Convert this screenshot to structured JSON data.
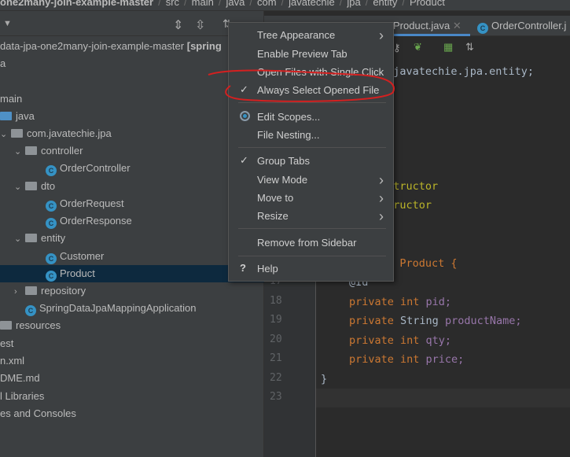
{
  "breadcrumb": [
    "one2many-join-example-master",
    "src",
    "main",
    "java",
    "com",
    "javatechie",
    "jpa",
    "entity",
    "Product"
  ],
  "project": {
    "root_label": "data-jpa-one2many-join-example-master",
    "root_suffix": "[spring",
    "rows": [
      {
        "label": "a",
        "indent": 0,
        "icon": "none"
      },
      {
        "label": "main",
        "indent": 0,
        "icon": "none"
      },
      {
        "label": "java",
        "indent": 0,
        "icon": "folder-blue"
      },
      {
        "label": "com.javatechie.jpa",
        "indent": 1,
        "icon": "package",
        "chevron": "down"
      },
      {
        "label": "controller",
        "indent": 2,
        "icon": "package",
        "chevron": "down"
      },
      {
        "label": "OrderController",
        "indent": 3,
        "icon": "class"
      },
      {
        "label": "dto",
        "indent": 2,
        "icon": "package",
        "chevron": "down"
      },
      {
        "label": "OrderRequest",
        "indent": 3,
        "icon": "class"
      },
      {
        "label": "OrderResponse",
        "indent": 3,
        "icon": "class"
      },
      {
        "label": "entity",
        "indent": 2,
        "icon": "package",
        "chevron": "down"
      },
      {
        "label": "Customer",
        "indent": 3,
        "icon": "class"
      },
      {
        "label": "Product",
        "indent": 3,
        "icon": "class",
        "selected": true
      },
      {
        "label": "repository",
        "indent": 2,
        "icon": "package",
        "chevron": "right"
      },
      {
        "label": "SpringDataJpaMappingApplication",
        "indent": 2,
        "icon": "spring-class"
      },
      {
        "label": "resources",
        "indent": 0,
        "icon": "folder-resources"
      },
      {
        "label": "est",
        "indent": 0,
        "icon": "none"
      },
      {
        "label": "n.xml",
        "indent": 0,
        "icon": "none"
      },
      {
        "label": "DME.md",
        "indent": 0,
        "icon": "none"
      },
      {
        "label": "l Libraries",
        "indent": 0,
        "icon": "none"
      },
      {
        "label": "es and Consoles",
        "indent": 0,
        "icon": "none"
      }
    ]
  },
  "tabs": [
    {
      "label": "Product.java",
      "active": true
    },
    {
      "label": "OrderController.j",
      "active": false
    }
  ],
  "menu": {
    "items": [
      {
        "label": "Tree Appearance",
        "submenu": true
      },
      {
        "label": "Enable Preview Tab"
      },
      {
        "label": "Open Files with Single Click"
      },
      {
        "label": "Always Select Opened File",
        "checked": true
      },
      {
        "label": "Edit Scopes...",
        "icon": "radio-icon"
      },
      {
        "label": "File Nesting..."
      },
      {
        "label": "Group Tabs",
        "checked": true
      },
      {
        "label": "View Mode",
        "submenu": true
      },
      {
        "label": "Move to",
        "submenu": true
      },
      {
        "label": "Resize",
        "submenu": true
      },
      {
        "label": "Remove from Sidebar"
      },
      {
        "label": "Help",
        "icon": "help-icon"
      }
    ]
  },
  "editor": {
    "package_line": "n.javatechie.jpa.entity;",
    "line_a": "nstructor",
    "line_b": "structor",
    "class_line": "ss Product {",
    "lines": [
      {
        "n": "17",
        "text": "@Id"
      },
      {
        "n": "18",
        "kw": "private ",
        "type": "int ",
        "name": "pid;"
      },
      {
        "n": "19",
        "kw": "private ",
        "type": "String ",
        "name": "productName;"
      },
      {
        "n": "20",
        "kw": "private ",
        "type": "int ",
        "name": "qty;"
      },
      {
        "n": "21",
        "kw": "private ",
        "type": "int ",
        "name": "price;"
      },
      {
        "n": "22",
        "text": "}"
      },
      {
        "n": "23",
        "text": ""
      }
    ]
  },
  "colors": {
    "annotation_circle": "#d42020",
    "selection": "#0d293e",
    "accent": "#4a88c7"
  }
}
